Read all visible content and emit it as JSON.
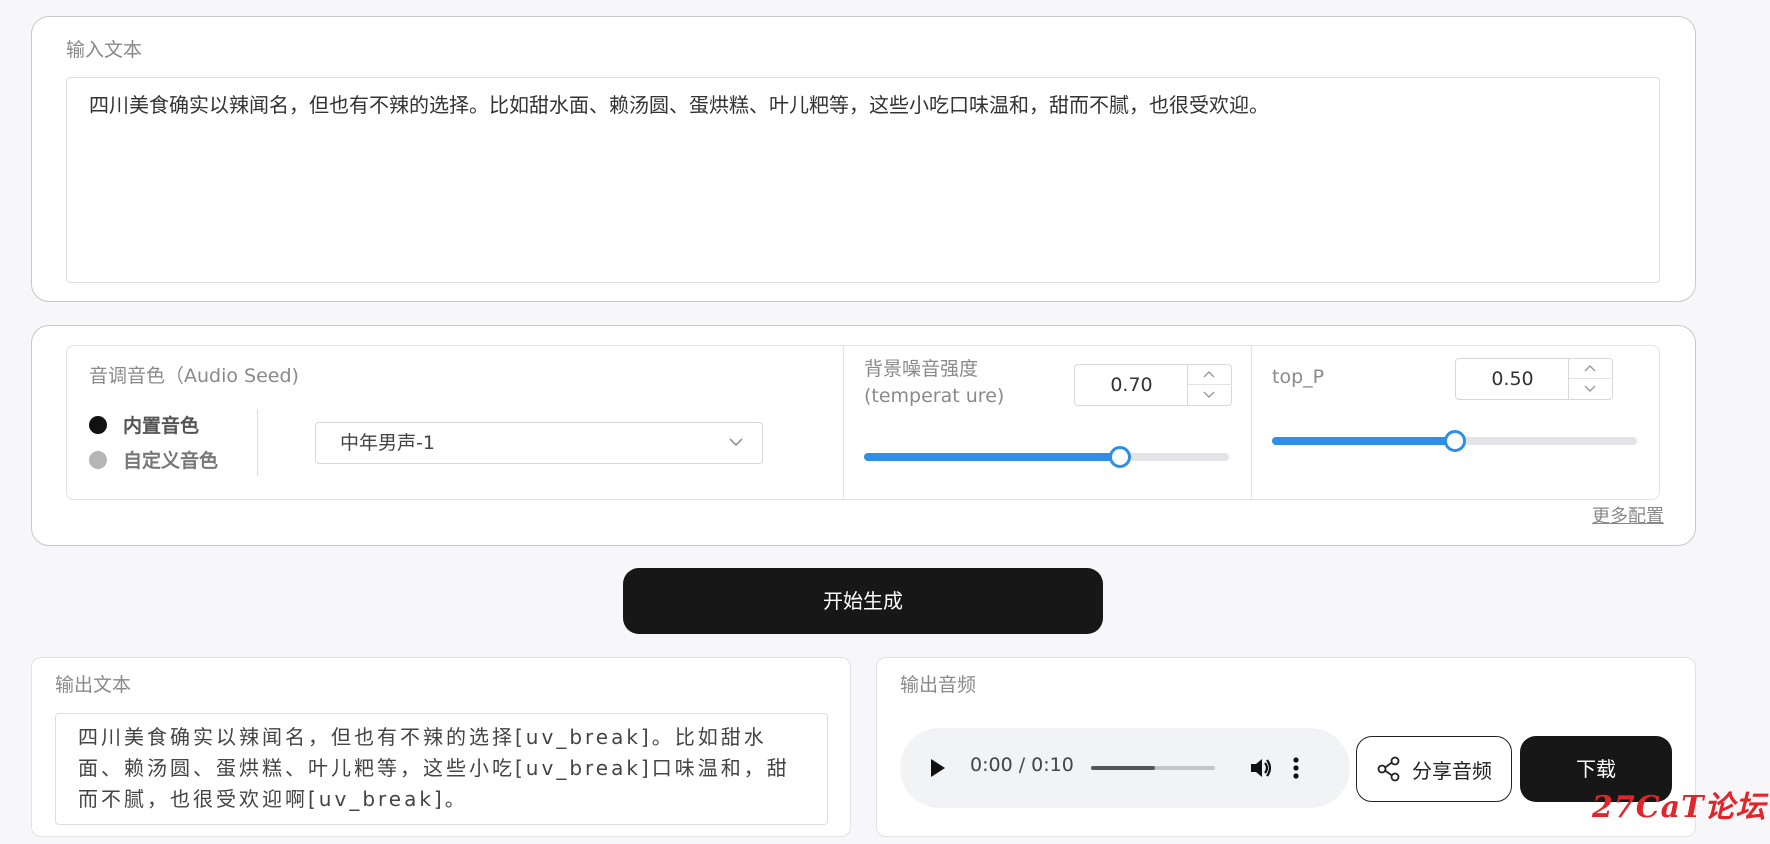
{
  "input": {
    "label": "输入文本",
    "text": "四川美食确实以辣闻名，但也有不辣的选择。比如甜水面、赖汤圆、蛋烘糕、叶儿粑等，这些小吃口味温和，甜而不腻，也很受欢迎。"
  },
  "config": {
    "seed_title": "音调音色（Audio Seed)",
    "radio_builtin": "内置音色",
    "radio_custom": "自定义音色",
    "selected_mode": "内置音色",
    "voice_value": "中年男声-1",
    "temperature": {
      "label": "背景噪音强度(temperat ure)",
      "value": "0.70",
      "fraction": 0.7
    },
    "top_p": {
      "label": "top_P",
      "value": "0.50",
      "fraction": 0.5
    },
    "more_config": "更多配置",
    "accent_color": "#2f8ee6"
  },
  "generate_button": "开始生成",
  "output_text": {
    "label": "输出文本",
    "text": "四川美食确实以辣闻名，但也有不辣的选择[uv_break]。比如甜水面、赖汤圆、蛋烘糕、叶儿粑等，这些小吃[uv_break]口味温和，甜而不腻，也很受欢迎啊[uv_break]。"
  },
  "output_audio": {
    "label": "输出音频",
    "time": "0:00 / 0:10",
    "progress_fraction": 0.52,
    "share_label": "分享音频",
    "download_label": "下载"
  },
  "icons": [
    "chevron-down-icon",
    "chevron-up-icon",
    "play-icon",
    "volume-icon",
    "more-vertical-icon",
    "share-icon"
  ],
  "watermark": "27CaT论坛"
}
